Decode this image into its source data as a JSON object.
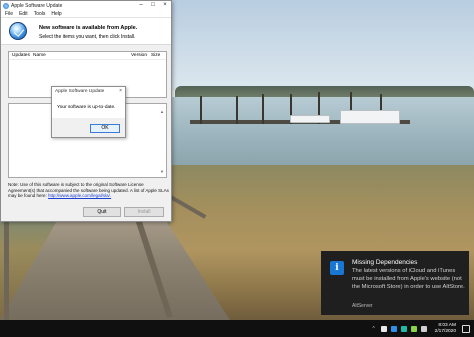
{
  "window": {
    "title": "Apple Software Update",
    "menu": [
      "File",
      "Edit",
      "Tools",
      "Help"
    ],
    "header_title": "New software is available from Apple.",
    "header_subtitle": "Select the items you want, then click Install.",
    "columns": [
      "Updates",
      "Name",
      "Version",
      "Size"
    ],
    "note": "Note: Use of this software is subject to the original Software License Agreement(s) that accompanied the software being updated. A list of Apple SLAs may be found here:",
    "note_link": "http://www.apple.com/legal/sla/.",
    "quit_label": "Quit",
    "install_label": "Install"
  },
  "dialog": {
    "title": "Apple Software Update",
    "message": "Your software is up-to-date.",
    "ok_label": "OK"
  },
  "notification": {
    "title": "Missing Dependencies",
    "body": "The latest versions of iCloud and iTunes must be installed from Apple's website (not the Microsoft Store) in order to use AltStore.",
    "source": "AltServer",
    "icon": "info-icon",
    "accent": "#1976d2"
  },
  "taskbar": {
    "time": "8:03 AM",
    "date": "2/17/2020",
    "tray_icons": [
      "chevron-up-icon",
      "dropbox-icon",
      "network-icon",
      "volume-icon",
      "altstore-icon",
      "notification-icon"
    ]
  }
}
